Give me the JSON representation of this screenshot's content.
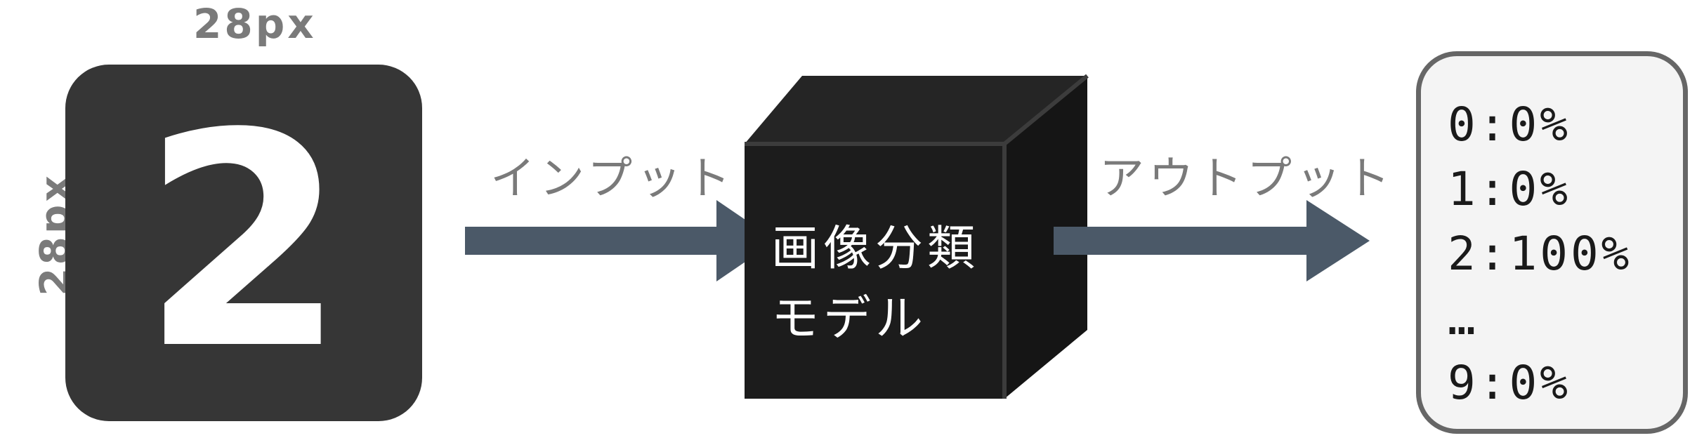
{
  "dimensions": {
    "width_label": "28px",
    "height_label": "28px"
  },
  "input_image": {
    "digit": "2",
    "background_color": "#363636",
    "digit_color": "#ffffff"
  },
  "arrows": {
    "input_label": "インプット",
    "output_label": "アウトプット",
    "color": "#4b5968"
  },
  "model": {
    "line1": "画像分類",
    "line2": "モデル",
    "color": "#1a1a1a"
  },
  "output": {
    "results": [
      "0:0%",
      "1:0%",
      "2:100%",
      "…",
      "9:0%"
    ],
    "panel_background": "#f4f4f4",
    "panel_border": "#666666"
  }
}
